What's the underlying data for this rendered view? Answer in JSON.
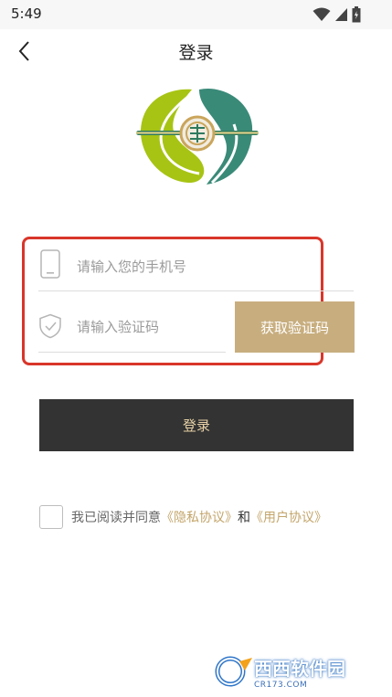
{
  "status_bar": {
    "time": "5:49"
  },
  "nav": {
    "title": "登录"
  },
  "form": {
    "phone_placeholder": "请输入您的手机号",
    "code_placeholder": "请输入验证码",
    "get_code_label": "获取验证码"
  },
  "login_button": {
    "label": "登录"
  },
  "agreement": {
    "prefix": "我已阅读并同意",
    "privacy": "《隐私协议》",
    "and": "和",
    "user": "《用户协议》"
  },
  "watermark": {
    "brand": "西西软件园",
    "site": "CR173.COM"
  },
  "colors": {
    "gold": "#c8ae7f",
    "dark_button": "#333333",
    "link": "#c3a56a",
    "annotation_red": "#d9362a",
    "logo_green": "#a7c414",
    "logo_teal": "#3a8a78"
  },
  "icons": [
    "back-arrow-icon",
    "wifi-icon",
    "signal-icon",
    "battery-icon",
    "phone-icon",
    "shield-check-icon",
    "app-logo"
  ]
}
